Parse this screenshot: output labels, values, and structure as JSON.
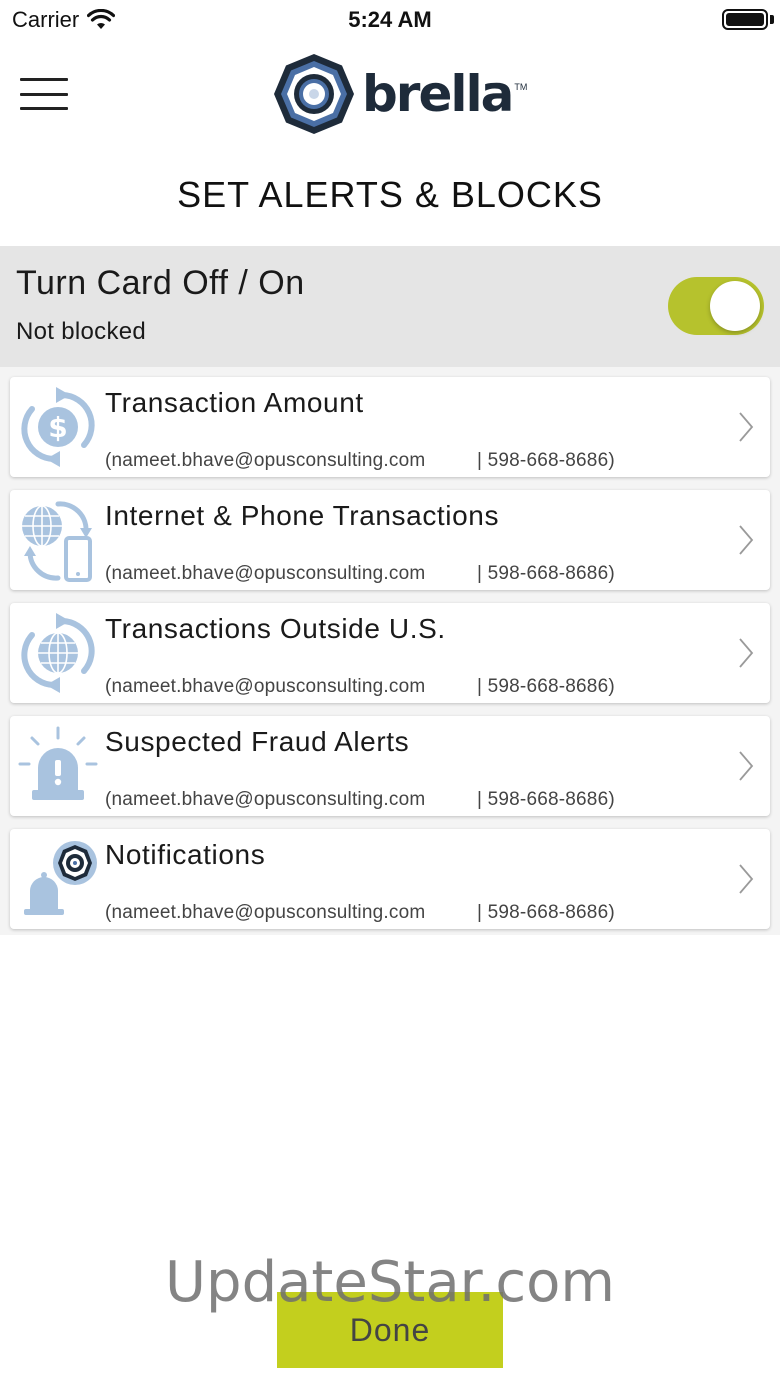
{
  "status_bar": {
    "carrier": "Carrier",
    "time": "5:24 AM"
  },
  "header": {
    "logo_text": "brella",
    "logo_tm": "TM",
    "title": "SET ALERTS & BLOCKS"
  },
  "card_toggle": {
    "title": "Turn Card Off / On",
    "status": "Not blocked",
    "is_on": true,
    "switch_color": "#b6c22d"
  },
  "alerts": [
    {
      "title": "Transaction Amount",
      "email": "(nameet.bhave@opusconsulting.com",
      "phone": "| 598-668-8686)",
      "icon": "dollar-refresh-icon"
    },
    {
      "title": "Internet & Phone Transactions",
      "email": "(nameet.bhave@opusconsulting.com",
      "phone": "| 598-668-8686)",
      "icon": "globe-phone-icon"
    },
    {
      "title": "Transactions Outside U.S.",
      "email": "(nameet.bhave@opusconsulting.com",
      "phone": "| 598-668-8686)",
      "icon": "globe-refresh-icon"
    },
    {
      "title": "Suspected Fraud Alerts",
      "email": "(nameet.bhave@opusconsulting.com",
      "phone": "| 598-668-8686)",
      "icon": "alarm-siren-icon"
    },
    {
      "title": "Notifications",
      "email": "(nameet.bhave@opusconsulting.com",
      "phone": "| 598-668-8686)",
      "icon": "bell-logo-icon"
    }
  ],
  "footer": {
    "done_label": "Done",
    "done_color": "#c3cf1e",
    "watermark": "UpdateStar.com"
  },
  "colors": {
    "accent_green": "#b6c22d",
    "icon_blue": "#a9c3df",
    "brand_navy": "#1e2b3a"
  }
}
